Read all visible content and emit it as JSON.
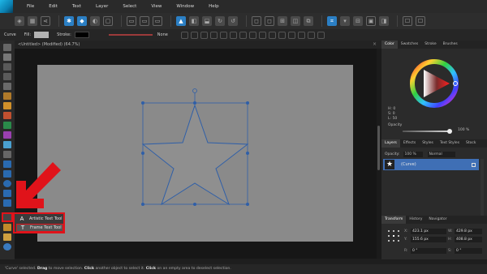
{
  "menubar": {
    "items": [
      "File",
      "Edit",
      "Text",
      "Layer",
      "Select",
      "View",
      "Window",
      "Help"
    ]
  },
  "context": {
    "curve_label": "Curve",
    "fill_label": "Fill:",
    "stroke_label": "Stroke:",
    "stroke_width_value": "None",
    "fill_color": "#b3b3b3",
    "stroke_color": "#000000"
  },
  "document": {
    "tab_title": "<Untitled> (Modified) (64.7%)",
    "close_glyph": "×"
  },
  "flyout": {
    "items": [
      {
        "label": "Artistic Text Tool",
        "icon": "A"
      },
      {
        "label": "Frame Text Tool",
        "icon": "T"
      }
    ]
  },
  "panels": {
    "color_tabs": [
      "Color",
      "Swatches",
      "Stroke",
      "Brushes"
    ],
    "hsl": [
      "H: 0",
      "S: 0",
      "L: 50"
    ],
    "opacity_label": "Opacity",
    "opacity_value": "100 %",
    "layer_tabs": [
      "Layers",
      "Effects",
      "Styles",
      "Text Styles",
      "Stock"
    ],
    "layers_opacity_label": "Opacity:",
    "layers_opacity_value": "100 %",
    "blend_mode": "Normal",
    "layer_name": "(Curve)",
    "transform_tabs": [
      "Transform",
      "History",
      "Navigator"
    ],
    "transform": {
      "x_key": "X:",
      "x_val": "423.1 px",
      "y_key": "Y:",
      "y_val": "155.6 px",
      "w_key": "W:",
      "w_val": "429.8 px",
      "h_key": "H:",
      "h_val": "408.8 px",
      "r_key": "R:",
      "r_val": "0 °",
      "s_key": "S:",
      "s_val": "0 °"
    }
  },
  "status": {
    "segments": [
      {
        "text": "'Curve' selected. ",
        "bold": false
      },
      {
        "text": "Drag",
        "bold": true
      },
      {
        "text": " to move selection. ",
        "bold": false
      },
      {
        "text": "Click",
        "bold": true
      },
      {
        "text": " another object to select it. ",
        "bold": false
      },
      {
        "text": "Click",
        "bold": true
      },
      {
        "text": " on an empty area to deselect selection.",
        "bold": false
      }
    ]
  },
  "colors": {
    "accent": "#2b7fc4",
    "highlight_red": "#e0131a",
    "layer_selected": "#3f6fb5"
  }
}
